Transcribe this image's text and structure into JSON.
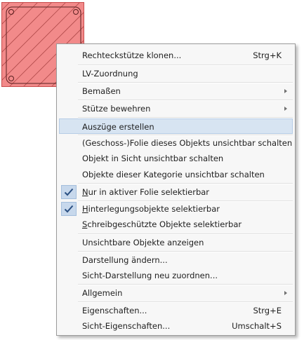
{
  "colors": {
    "column_fill": "#f28a8a",
    "column_border": "#c84c4c",
    "menu_background": "#f7f7f7",
    "highlight": "#d7e4f2",
    "check_background": "#c7d8ec"
  },
  "context_menu": {
    "items": [
      {
        "label": "Rechteckstütze klonen...",
        "shortcut": "Strg+K"
      },
      {
        "label": "LV-Zuordnung"
      },
      {
        "label": "Bemaßen",
        "submenu": true
      },
      {
        "label": "Stütze bewehren",
        "submenu": true
      },
      {
        "label": "Auszüge erstellen",
        "highlighted": true
      },
      {
        "label": "(Geschoss-)Folie dieses Objekts unsichtbar schalten"
      },
      {
        "label": "Objekt in Sicht unsichtbar schalten"
      },
      {
        "label": "Objekte dieser Kategorie unsichtbar schalten"
      },
      {
        "label_mnemonic": "N",
        "label_rest": "ur in aktiver Folie selektierbar",
        "checked": true
      },
      {
        "label_mnemonic": "H",
        "label_rest": "interlegungsobjekte selektierbar",
        "checked": true
      },
      {
        "label_mnemonic": "S",
        "label_rest": "chreibgeschützte Objekte selektierbar"
      },
      {
        "label": "Unsichtbare Objekte anzeigen"
      },
      {
        "label": "Darstellung ändern..."
      },
      {
        "label": "Sicht-Darstellung neu zuordnen..."
      },
      {
        "label": "Allgemein",
        "submenu": true
      },
      {
        "label": "Eigenschaften...",
        "shortcut": "Strg+E"
      },
      {
        "label": "Sicht-Eigenschaften...",
        "shortcut": "Umschalt+S"
      }
    ]
  }
}
